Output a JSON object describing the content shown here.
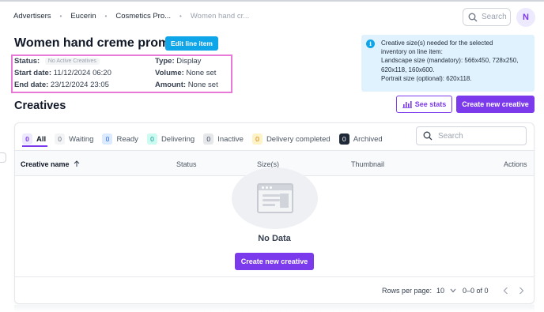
{
  "breadcrumb": {
    "items": [
      "Advertisers",
      "Eucerin",
      "Cosmetics Pro...",
      "Women hand cr..."
    ],
    "separator": "•"
  },
  "header": {
    "search_placeholder": "Search",
    "avatar_initial": "N"
  },
  "line_item": {
    "title": "Women hand creme promo",
    "edit_label": "Edit line item",
    "status_label": "Status:",
    "status_value": "No Active Creatives",
    "start_label": "Start date:",
    "start_value": "11/12/2024 06:20",
    "end_label": "End date:",
    "end_value": "23/12/2024 23:05",
    "type_label": "Type:",
    "type_value": "Display",
    "volume_label": "Volume:",
    "volume_value": "None set",
    "amount_label": "Amount:",
    "amount_value": "None set"
  },
  "info": {
    "icon": "i",
    "line1": "Creative size(s) needed for the selected",
    "line2": "inventory on line item:",
    "line3": "Landscape size (mandatory): 566x450, 728x250,",
    "line4": "620x118, 160x600.",
    "line5": "Portrait size (optional): 620x118."
  },
  "creatives": {
    "title": "Creatives",
    "see_stats_label": "See stats",
    "new_creative_label": "Create new creative",
    "search_placeholder": "Search",
    "tabs": [
      {
        "count": "0",
        "label": "All"
      },
      {
        "count": "0",
        "label": "Waiting"
      },
      {
        "count": "0",
        "label": "Ready"
      },
      {
        "count": "0",
        "label": "Delivering"
      },
      {
        "count": "0",
        "label": "Inactive"
      },
      {
        "count": "0",
        "label": "Delivery completed"
      },
      {
        "count": "0",
        "label": "Archived"
      }
    ],
    "columns": {
      "name": "Creative name",
      "status": "Status",
      "sizes": "Size(s)",
      "thumbnail": "Thumbnail",
      "actions": "Actions"
    },
    "empty_text": "No Data",
    "empty_button": "Create new creative",
    "rows_per_page_label": "Rows per page:",
    "rows_per_page_value": "10",
    "range": "0–0 of 0"
  },
  "colors": {
    "accent": "#7c3aed",
    "edit_button": "#0ea5e9",
    "info_bg": "#e0f2fe",
    "highlight_border": "#e879d9"
  },
  "icons": [
    "search-icon",
    "chart-icon",
    "info-icon",
    "sort-arrow-icon",
    "chevron-down-icon",
    "chevron-left-icon",
    "chevron-right-icon",
    "empty-state-icon"
  ]
}
